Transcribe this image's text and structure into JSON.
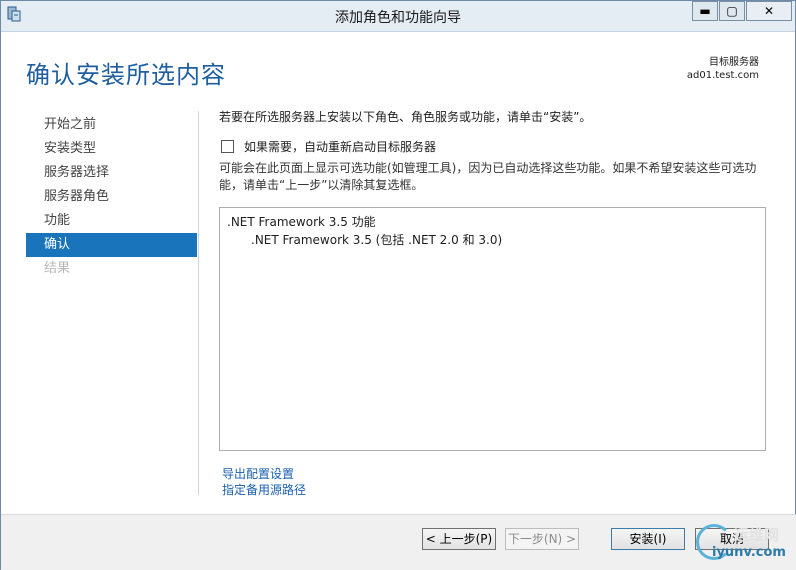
{
  "window": {
    "title": "添加角色和功能向导",
    "controls": {
      "minimize": "▬",
      "maximize": "▢",
      "close": "✕"
    }
  },
  "page": {
    "heading": "确认安装所选内容",
    "destination_label": "目标服务器",
    "destination_server": "ad01.test.com"
  },
  "nav": {
    "items": [
      {
        "label": "开始之前",
        "state": "normal"
      },
      {
        "label": "安装类型",
        "state": "normal"
      },
      {
        "label": "服务器选择",
        "state": "normal"
      },
      {
        "label": "服务器角色",
        "state": "normal"
      },
      {
        "label": "功能",
        "state": "normal"
      },
      {
        "label": "确认",
        "state": "active"
      },
      {
        "label": "结果",
        "state": "disabled"
      }
    ]
  },
  "content": {
    "intro": "若要在所选服务器上安装以下角色、角色服务或功能，请单击“安装”。",
    "restart_label": "如果需要，自动重新启动目标服务器",
    "restart_checked": false,
    "note": "可能会在此页面上显示可选功能(如管理工具)，因为已自动选择这些功能。如果不希望安装这些可选功能，请单击“上一步”以清除其复选框。",
    "features": [
      {
        "label": ".NET Framework 3.5 功能",
        "level": 0
      },
      {
        "label": ".NET Framework 3.5 (包括 .NET 2.0 和 3.0)",
        "level": 1
      }
    ],
    "links": {
      "export": "导出配置设置",
      "alt_source": "指定备用源路径"
    }
  },
  "footer": {
    "prev": "< 上一步(P)",
    "next": "下一步(N) >",
    "install": "安装(I)",
    "cancel": "取消"
  },
  "watermark": {
    "cn": "运维网",
    "en": "iyunv.com"
  },
  "colors": {
    "heading": "#1f5fa0",
    "nav_active_bg": "#1a74bc",
    "link": "#1a5fb0",
    "nav_disabled": "#b8b8b8"
  }
}
